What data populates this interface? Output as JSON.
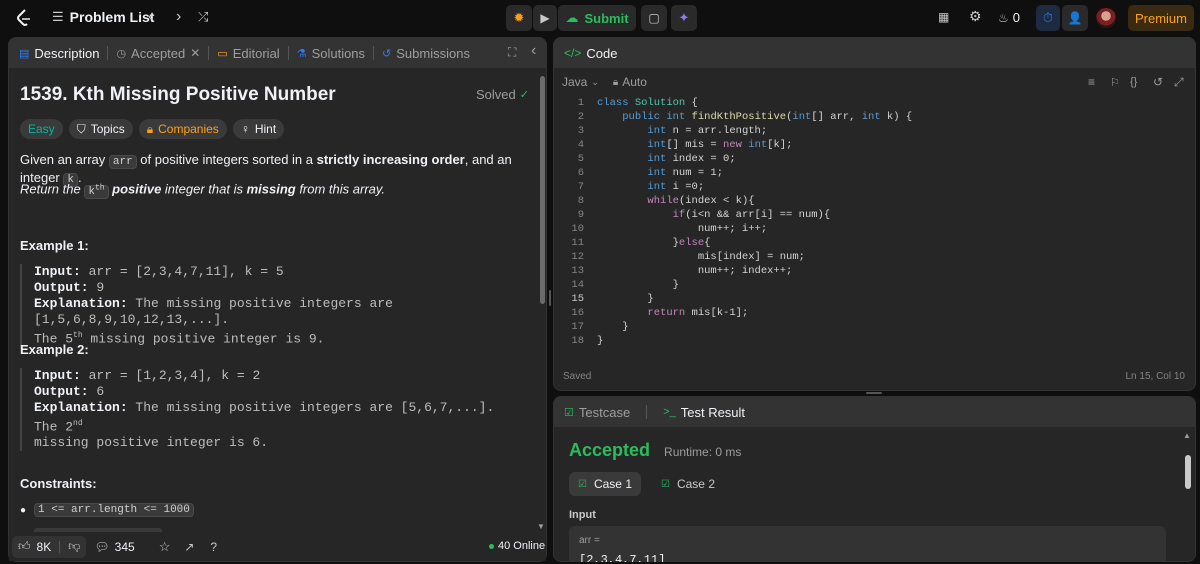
{
  "topbar": {
    "problem_list_label": "Problem List",
    "submit_label": "Submit",
    "streak_count": "0",
    "premium_label": "Premium"
  },
  "left_panel": {
    "tabs": [
      {
        "label": "Description"
      },
      {
        "label": "Accepted"
      },
      {
        "label": "Editorial"
      },
      {
        "label": "Solutions"
      },
      {
        "label": "Submissions"
      }
    ],
    "title": "1539. Kth Missing Positive Number",
    "solved_label": "Solved",
    "tags": {
      "difficulty": "Easy",
      "topics": "Topics",
      "companies": "Companies",
      "hint": "Hint"
    },
    "para1": {
      "a": "Given an array ",
      "code1": "arr",
      "b": " of positive integers sorted in a ",
      "strong": "strictly increasing order",
      "c": ", and an integer ",
      "code2": "k",
      "d": "."
    },
    "para2": {
      "a": "Return the ",
      "code": "k",
      "sup": "th",
      "b": " ",
      "strong1": "positive",
      "c": " integer that is ",
      "strong2": "missing",
      "d": " from this array."
    },
    "example1": {
      "heading": "Example 1:",
      "input_label": "Input:",
      "input_value": " arr = [2,3,4,7,11], k = 5",
      "output_label": "Output:",
      "output_value": " 9",
      "explanation_label": "Explanation:",
      "explanation_value": " The missing positive integers are [1,5,6,8,9,10,12,13,...].",
      "explanation_line2_a": "The 5",
      "explanation_line2_sup": "th",
      "explanation_line2_b": " missing positive integer is 9."
    },
    "example2": {
      "heading": "Example 2:",
      "input_label": "Input:",
      "input_value": " arr = [1,2,3,4], k = 2",
      "output_label": "Output:",
      "output_value": " 6",
      "explanation_label": "Explanation:",
      "explanation_value": " The missing positive integers are [5,6,7,...]. The 2",
      "explanation_sup": "nd",
      "explanation_line2": "missing positive integer is 6."
    },
    "constraints": {
      "heading": "Constraints:",
      "items": [
        "1 <= arr.length <= 1000"
      ]
    },
    "footer": {
      "likes": "8K",
      "comments": "345",
      "online": "40 Online"
    }
  },
  "code_panel": {
    "title": "Code",
    "language": "Java",
    "mode": "Auto",
    "status": "Saved",
    "cursor": "Ln 15, Col 10",
    "lines": [
      "class Solution {",
      "    public int findKthPositive(int[] arr, int k) {",
      "        int n = arr.length;",
      "        int[] mis = new int[k];",
      "        int index = 0;",
      "        int num = 1;",
      "        int i =0;",
      "        while(index < k){",
      "            if(i<n && arr[i] == num){",
      "                num++; i++;",
      "            }else{",
      "                mis[index] = num;",
      "                num++; index++;",
      "            }",
      "        }",
      "        return mis[k-1];",
      "    }",
      "}"
    ]
  },
  "test_panel": {
    "tab_testcase": "Testcase",
    "tab_result": "Test Result",
    "result": "Accepted",
    "runtime": "Runtime: 0 ms",
    "case1": "Case 1",
    "case2": "Case 2",
    "input_label": "Input",
    "arr_label": "arr =",
    "arr_value": "[2,3,4,7,11]"
  },
  "colors": {
    "accent_green": "#2cbb5d",
    "easy": "#00b8a3",
    "premium": "#ffa116",
    "timer_blue": "#2f7cf6"
  }
}
